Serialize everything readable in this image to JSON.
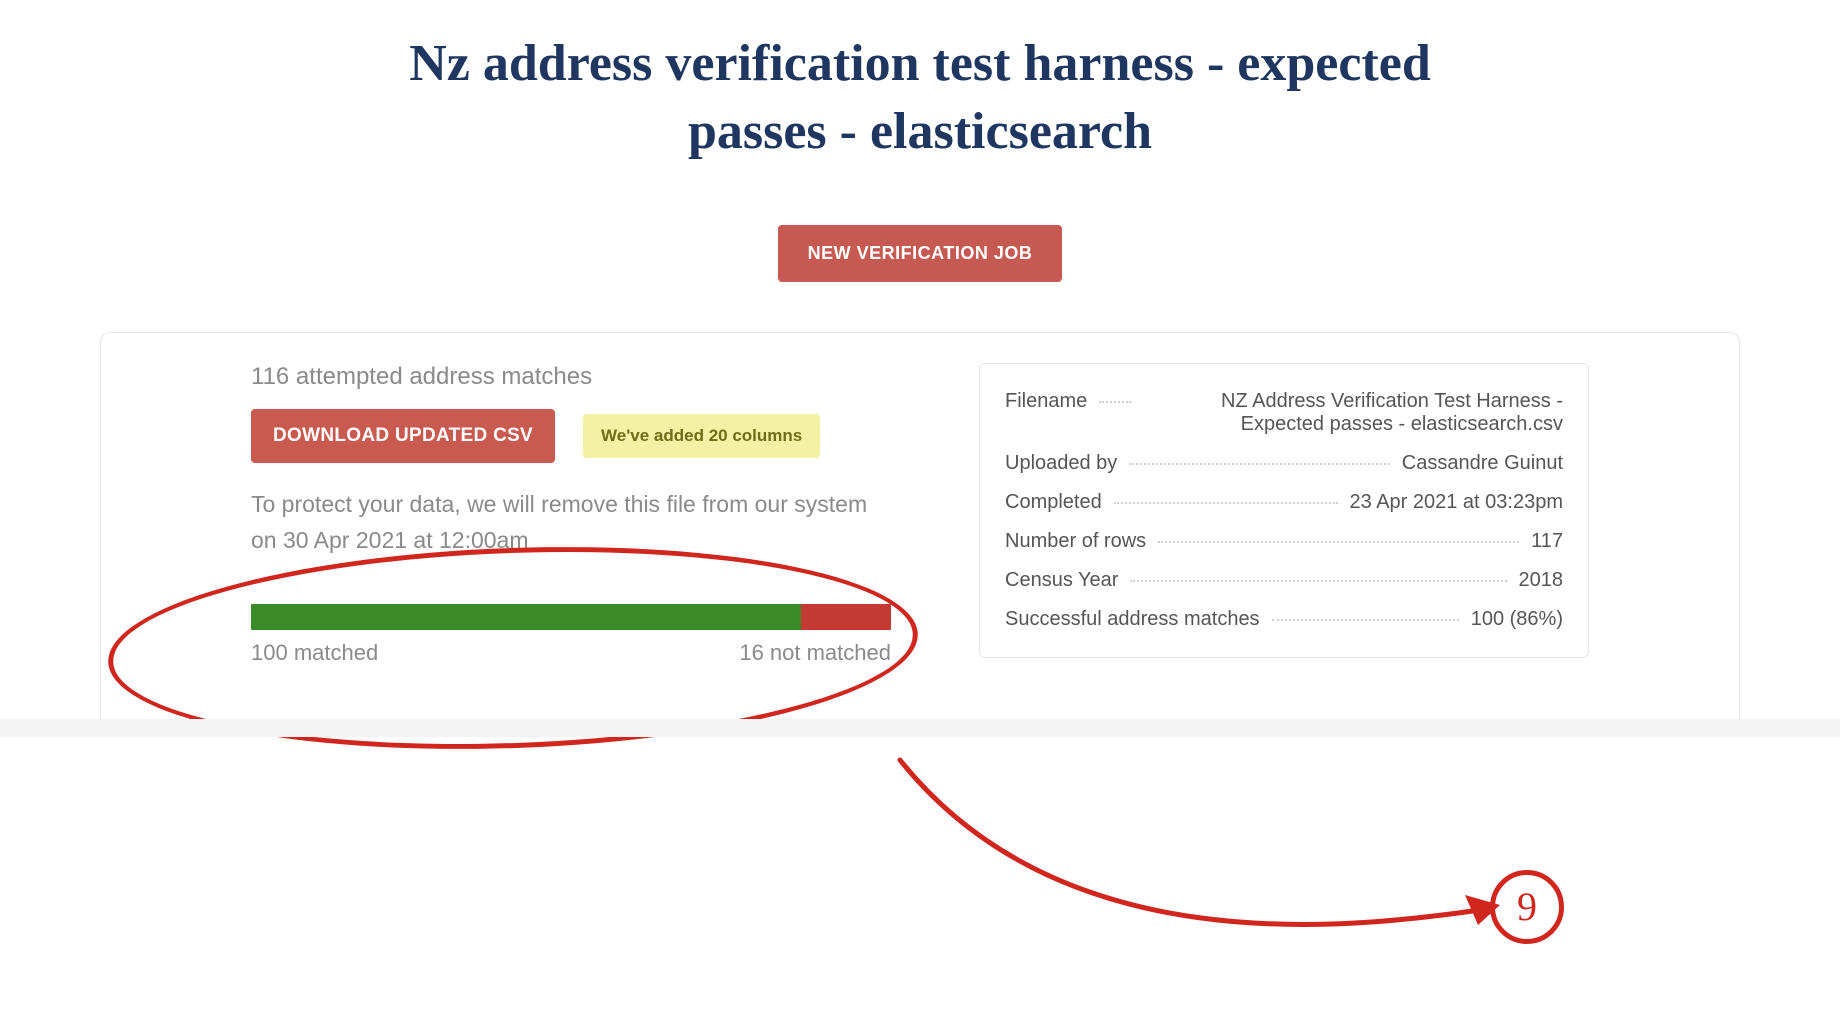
{
  "page": {
    "title": "Nz address verification test harness - expected passes - elasticsearch"
  },
  "actions": {
    "new_job_label": "NEW VERIFICATION JOB",
    "download_csv_label": "DOWNLOAD UPDATED CSV"
  },
  "summary": {
    "attempts_text": "116 attempted address matches",
    "columns_added_tag": "We've added 20 columns",
    "retention_note": "To protect your data, we will remove this file from our system on 30 Apr 2021 at 12:00am",
    "bar": {
      "matched_pct": 86,
      "not_matched_pct": 14,
      "matched_label": "100 matched",
      "not_matched_label": "16 not matched"
    }
  },
  "meta": {
    "filename_label": "Filename",
    "filename_value": "NZ Address Verification Test Harness - Expected passes - elasticsearch.csv",
    "uploaded_by_label": "Uploaded by",
    "uploaded_by_value": "Cassandre Guinut",
    "completed_label": "Completed",
    "completed_value": "23 Apr 2021 at 03:23pm",
    "rows_label": "Number of rows",
    "rows_value": "117",
    "census_label": "Census Year",
    "census_value": "2018",
    "success_label": "Successful address matches",
    "success_value": "100 (86%)"
  },
  "annotation": {
    "step_number": "9"
  },
  "colors": {
    "primary_red": "#c65a52",
    "title_blue": "#1f3660",
    "bar_green": "#3a8b28",
    "bar_red": "#c23a31",
    "annotation_red": "#d1261d"
  },
  "chart_data": {
    "type": "bar",
    "title": "Address match results",
    "categories": [
      "matched",
      "not matched"
    ],
    "values": [
      100,
      16
    ],
    "total": 116,
    "percent_matched": 86
  }
}
